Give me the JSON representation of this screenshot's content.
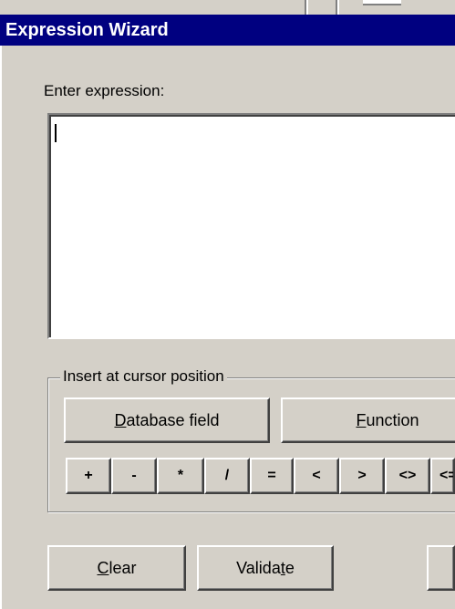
{
  "window": {
    "title": "Expression Wizard"
  },
  "expression": {
    "label": "Enter expression:",
    "value": ""
  },
  "insert_group": {
    "legend": "Insert at cursor position",
    "database_field_button": {
      "pre": "",
      "accel": "D",
      "post": "atabase field"
    },
    "function_button": {
      "pre": "",
      "accel": "F",
      "post": "unction"
    },
    "operators": [
      "+",
      "-",
      "*",
      "/",
      "=",
      "<",
      ">",
      "<>",
      "<="
    ]
  },
  "actions": {
    "clear_button": {
      "pre": "",
      "accel": "C",
      "post": "lear"
    },
    "validate_button": {
      "pre": "Valida",
      "accel": "t",
      "post": "e"
    }
  }
}
